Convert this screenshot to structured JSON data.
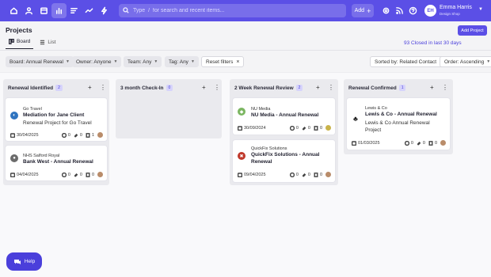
{
  "nav": {
    "icons": [
      "home-icon",
      "user-icon",
      "calendar-icon",
      "bar-chart-icon",
      "list-icon",
      "trend-icon",
      "bolt-icon"
    ],
    "active_index": 3
  },
  "search": {
    "placeholder": "Type  /  for search and recent items..."
  },
  "topbar": {
    "add_label": "Add",
    "user_initials": "EH",
    "user_name": "Emma Harris",
    "user_role": "Design Shop"
  },
  "page": {
    "title": "Projects",
    "add_project_label": "Add Project",
    "tabs": [
      {
        "label": "Board",
        "active": true
      },
      {
        "label": "List",
        "active": false
      }
    ],
    "closed_link": "93 Closed in last 30 days"
  },
  "filters": {
    "board": "Board: Annual Renewal",
    "owner": "Owner: Anyone",
    "team": "Team: Any",
    "tag": "Tag: Any",
    "reset": "Reset filters",
    "sort": "Sorted by: Related Contact",
    "order": "Order: Ascending"
  },
  "columns": [
    {
      "title": "Renewal Identified",
      "count": "2",
      "cards": [
        {
          "org": "Go Travel",
          "title": "Mediation for Jane Client",
          "subtitle": "Renewal Project for Go Travel",
          "date": "30/04/2025",
          "checks": "0",
          "attachments": "0",
          "docs": "1",
          "logo_color": "#2f74c0",
          "logo_glyph": "◐"
        },
        {
          "org": "NHS Salford Royal",
          "title": "Bank West - Annual Renewal",
          "subtitle": "",
          "date": "04/04/2025",
          "checks": "0",
          "attachments": "0",
          "docs": "0",
          "logo_color": "#6b6b6b",
          "logo_glyph": "●"
        }
      ]
    },
    {
      "title": "3 month Check-In",
      "count": "0",
      "cards": []
    },
    {
      "title": "2 Week Renewal Review",
      "count": "2",
      "cards": [
        {
          "org": "NU Media",
          "title": "NU Media - Annual Renewal",
          "subtitle": "",
          "date": "30/09/2024",
          "checks": "0",
          "attachments": "0",
          "docs": "0",
          "logo_color": "#7bb661",
          "logo_glyph": "◆"
        },
        {
          "org": "QuickFix Solutions",
          "title": "QuickFix Solutions - Annual Renewal",
          "subtitle": "",
          "date": "09/04/2025",
          "checks": "0",
          "attachments": "0",
          "docs": "0",
          "logo_color": "#c0392b",
          "logo_glyph": "✖"
        }
      ]
    },
    {
      "title": "Renewal Confirmed",
      "count": "1",
      "cards": [
        {
          "org": "Lewis & Co",
          "title": "Lewis & Co - Annual Renewal",
          "subtitle": "Lewis & Co Annual Renewal Project",
          "date": "01/03/2025",
          "checks": "0",
          "attachments": "0",
          "docs": "0",
          "logo_color": "#222222",
          "logo_glyph": "♣"
        }
      ]
    }
  ],
  "help": {
    "label": "Help"
  }
}
